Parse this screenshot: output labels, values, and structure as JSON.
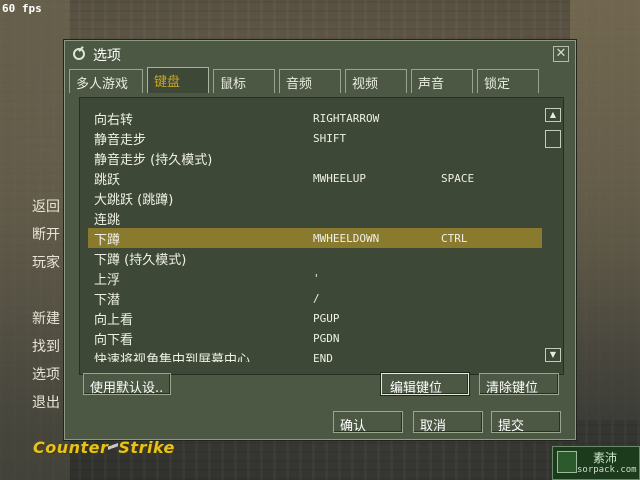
{
  "hud": {
    "fps": "60 fps"
  },
  "side_menu": [
    "返回",
    "断开",
    "玩家",
    "新建",
    "找到",
    "选项",
    "退出"
  ],
  "logo": {
    "left": "Counter",
    "right": "Strike",
    "color": "#e6c21a"
  },
  "watermark": {
    "text": "素沛",
    "url": "sorpack.com"
  },
  "dialog": {
    "title": "选项",
    "tabs": [
      "多人游戏",
      "键盘",
      "鼠标",
      "音频",
      "视频",
      "声音",
      "锁定"
    ],
    "active_tab": "键盘",
    "bindings": [
      {
        "action": "向右转",
        "key1": "RIGHTARROW",
        "key2": ""
      },
      {
        "action": "静音走步",
        "key1": "SHIFT",
        "key2": ""
      },
      {
        "action": "静音走步 (持久模式)",
        "key1": "",
        "key2": ""
      },
      {
        "action": "跳跃",
        "key1": "MWHEELUP",
        "key2": "SPACE"
      },
      {
        "action": "大跳跃 (跳蹲)",
        "key1": "",
        "key2": ""
      },
      {
        "action": "连跳",
        "key1": "",
        "key2": ""
      },
      {
        "action": "下蹲",
        "key1": "MWHEELDOWN",
        "key2": "CTRL"
      },
      {
        "action": "下蹲 (持久模式)",
        "key1": "",
        "key2": ""
      },
      {
        "action": "上浮",
        "key1": "'",
        "key2": ""
      },
      {
        "action": "下潜",
        "key1": "/",
        "key2": ""
      },
      {
        "action": "向上看",
        "key1": "PGUP",
        "key2": ""
      },
      {
        "action": "向下看",
        "key1": "PGDN",
        "key2": ""
      },
      {
        "action": "快速将视角集中到屏幕中心",
        "key1": "END",
        "key2": ""
      }
    ],
    "selected_action": "下蹲",
    "buttons": {
      "defaults": "使用默认设..",
      "edit": "编辑键位",
      "clear": "清除键位",
      "ok": "确认",
      "cancel": "取消",
      "apply": "提交"
    },
    "colors": {
      "background": "#4c5844",
      "panel": "#3e4836",
      "selection": "#8a7a2e",
      "active_tab": "#c8a42a"
    }
  }
}
